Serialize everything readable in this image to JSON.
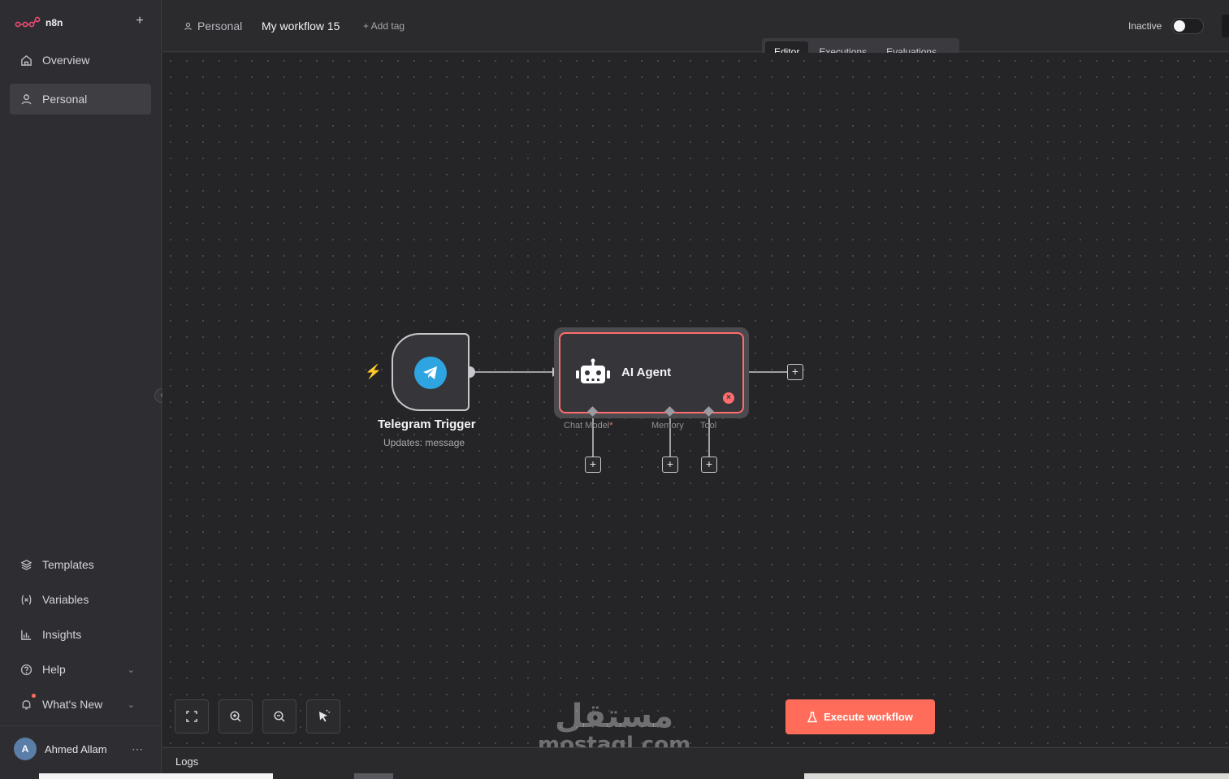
{
  "app": {
    "logo_text": "n8n"
  },
  "sidebar": {
    "top_items": [
      {
        "label": "Overview",
        "icon": "home-icon"
      },
      {
        "label": "Personal",
        "icon": "user-icon",
        "active": true
      }
    ],
    "bottom_items": [
      {
        "label": "Templates",
        "icon": "templates-icon"
      },
      {
        "label": "Variables",
        "icon": "variables-icon"
      },
      {
        "label": "Insights",
        "icon": "insights-icon"
      },
      {
        "label": "Help",
        "icon": "help-icon"
      },
      {
        "label": "What's New",
        "icon": "bell-icon"
      }
    ],
    "user": {
      "name": "Ahmed Allam",
      "initial": "A"
    }
  },
  "header": {
    "breadcrumb": "Personal",
    "workflow_name": "My workflow 15",
    "add_tag": "+ Add tag",
    "status_label": "Inactive",
    "active": false
  },
  "tabs": [
    {
      "label": "Editor",
      "active": true
    },
    {
      "label": "Executions",
      "active": false
    },
    {
      "label": "Evaluations",
      "active": false
    }
  ],
  "nodes": {
    "trigger": {
      "title": "Telegram Trigger",
      "subtitle": "Updates: message"
    },
    "agent": {
      "title": "AI Agent",
      "ports": [
        "Chat Model",
        "Memory",
        "Tool"
      ],
      "required_port_marker": "*"
    }
  },
  "canvas_controls": [
    "fit-view-icon",
    "zoom-in-icon",
    "zoom-out-icon",
    "tidy-up-icon"
  ],
  "execute_button": {
    "label": "Execute workflow"
  },
  "watermark": {
    "arabic": "مستقل",
    "latin": "mostaql.com"
  },
  "logs": {
    "label": "Logs"
  },
  "colors": {
    "accent": "#ff6d5a",
    "error": "#ff6d6d",
    "telegram": "#2ea4e0"
  }
}
